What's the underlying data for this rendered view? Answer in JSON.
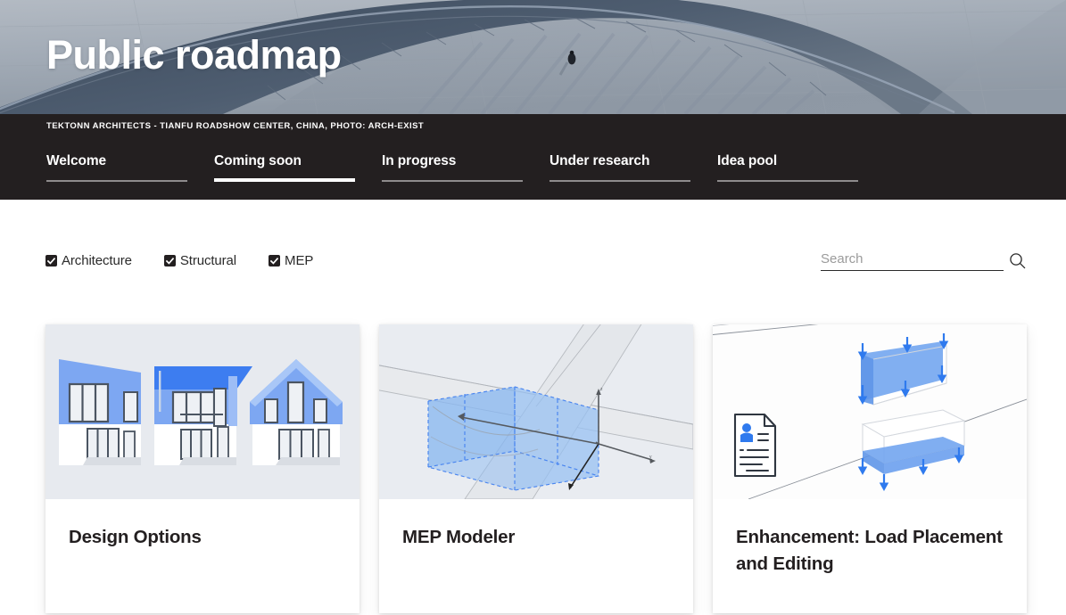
{
  "hero": {
    "title": "Public roadmap",
    "photo_credit": "TEKTONN ARCHITECTS - TIANFU ROADSHOW CENTER, CHINA, PHOTO: ARCH-EXIST"
  },
  "nav": {
    "tabs": [
      {
        "label": "Welcome",
        "active": false,
        "rule_width": 158
      },
      {
        "label": "Coming soon",
        "active": true,
        "rule_width": 158
      },
      {
        "label": "In progress",
        "active": false,
        "rule_width": 158
      },
      {
        "label": "Under research",
        "active": false,
        "rule_width": 158
      },
      {
        "label": "Idea pool",
        "active": false,
        "rule_width": 158
      }
    ]
  },
  "toolbar": {
    "filters": [
      {
        "label": "Architecture",
        "checked": true
      },
      {
        "label": "Structural",
        "checked": true
      },
      {
        "label": "MEP",
        "checked": true
      }
    ],
    "search": {
      "placeholder": "Search",
      "value": "",
      "icon": "search-icon"
    }
  },
  "cards": [
    {
      "title": "Design Options",
      "media": "house-facade-variants-illustration",
      "accent": "#79a6f2"
    },
    {
      "title": "MEP Modeler",
      "media": "mep-duct-intersection-3d-illustration",
      "accent": "#aecbf5"
    },
    {
      "title": "Enhancement: Load Placement and Editing",
      "media": "structural-load-placement-illustration",
      "accent": "#76a8f0"
    }
  ],
  "colors": {
    "nav_background": "#231f20",
    "page_background": "#ffffff",
    "card_media_background": "#e7eaef",
    "accent_blue": "#3d7df0",
    "text_dark": "#231f20",
    "rule_inactive": "#8e8b8c"
  }
}
